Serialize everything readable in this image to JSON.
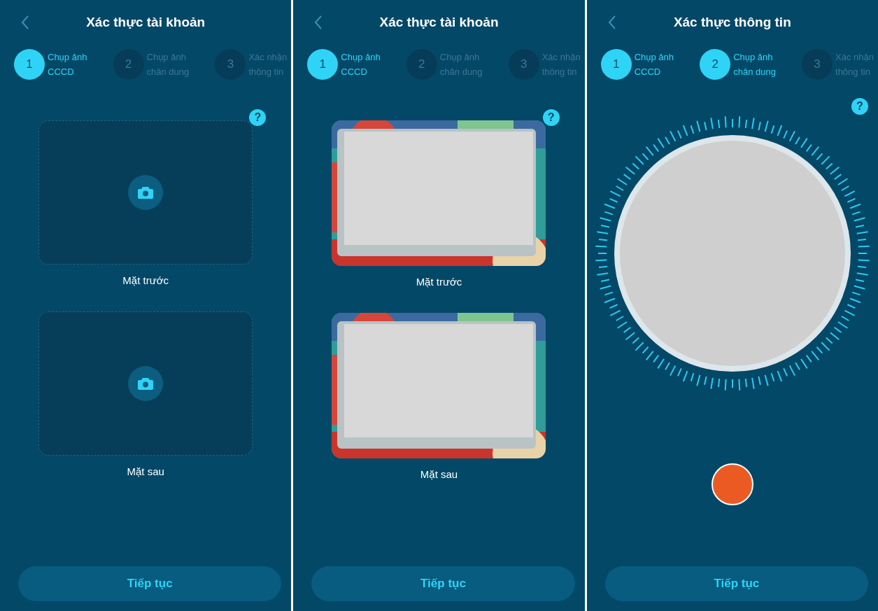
{
  "screens": [
    {
      "kind": "documents",
      "title": "Xác thực tài khoản",
      "steps": [
        {
          "number": "1",
          "lines": [
            "Chụp ảnh",
            "CCCD"
          ],
          "selected": true
        },
        {
          "number": "2",
          "lines": [
            "Chụp ảnh",
            "chân dung"
          ],
          "selected": false
        },
        {
          "number": "3",
          "lines": [
            "Xác nhận",
            "thông tin"
          ],
          "selected": false
        }
      ],
      "help": "?",
      "cards": [
        {
          "kind": "empty",
          "label": "Mặt trước"
        },
        {
          "kind": "empty",
          "label": "Mặt sau"
        }
      ],
      "button": "Tiếp tục"
    },
    {
      "kind": "documents",
      "title": "Xác thực tài khoản",
      "steps": [
        {
          "number": "1",
          "lines": [
            "Chụp ảnh",
            "CCCD"
          ],
          "selected": true
        },
        {
          "number": "2",
          "lines": [
            "Chụp ảnh",
            "chân dung"
          ],
          "selected": false
        },
        {
          "number": "3",
          "lines": [
            "Xác nhận",
            "thông tin"
          ],
          "selected": false
        }
      ],
      "help": "?",
      "cards": [
        {
          "label": "Mặt trước"
        },
        {
          "label": "Mặt sau"
        }
      ],
      "button": "Tiếp tục"
    },
    {
      "kind": "face",
      "title": "Xác thực thông tin",
      "steps": [
        {
          "number": "1",
          "lines": [
            "Chụp ảnh",
            "CCCD"
          ],
          "selected": true
        },
        {
          "number": "2",
          "lines": [
            "Chụp ảnh",
            "chân dung"
          ],
          "selected": true
        },
        {
          "number": "3",
          "lines": [
            "Xác nhận",
            "thông tin"
          ],
          "selected": false
        }
      ],
      "help": "?",
      "button": "Tiếp tục"
    }
  ]
}
